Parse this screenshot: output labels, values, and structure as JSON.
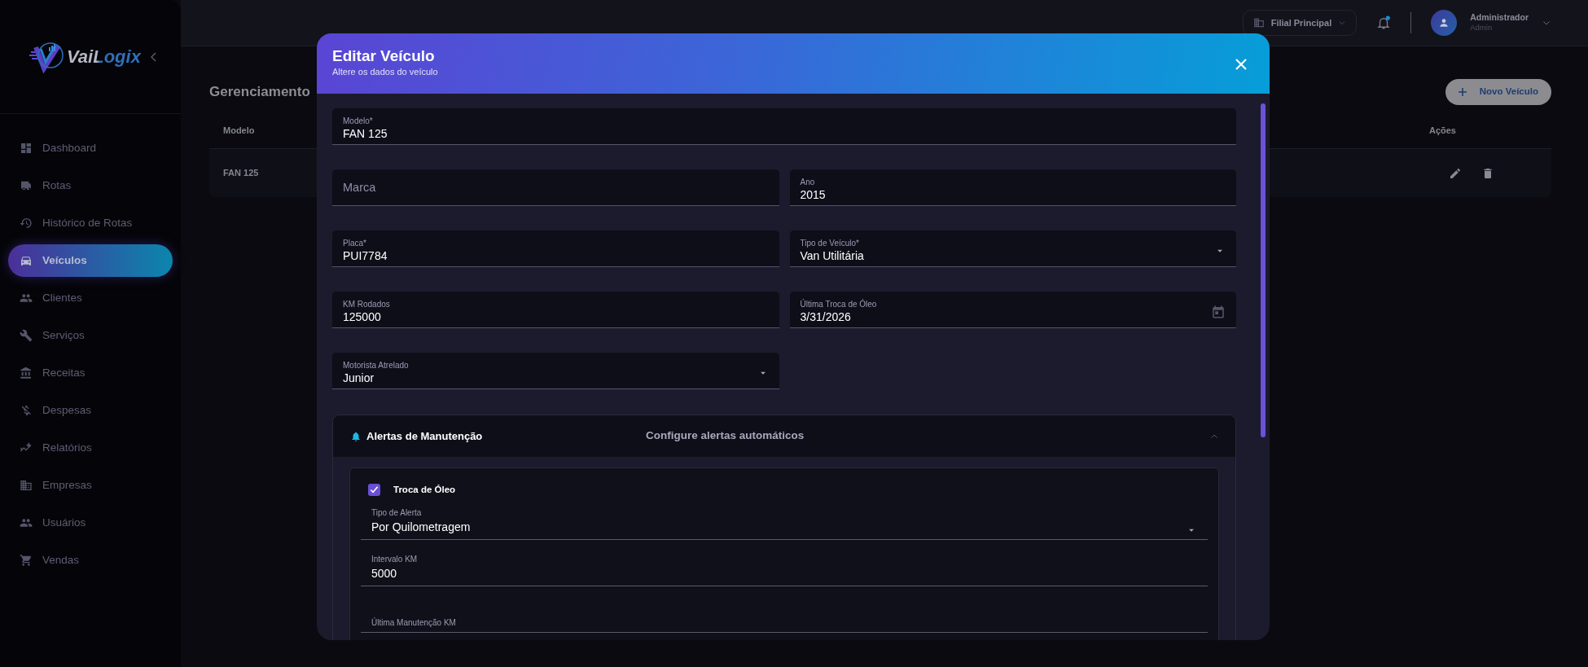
{
  "sidebar": {
    "logo_text": "VaiLogix",
    "items": [
      {
        "label": "Dashboard",
        "selected": false
      },
      {
        "label": "Rotas",
        "selected": false
      },
      {
        "label": "Histórico de Rotas",
        "selected": false
      },
      {
        "label": "Veículos",
        "selected": true
      },
      {
        "label": "Clientes",
        "selected": false
      },
      {
        "label": "Serviços",
        "selected": false
      },
      {
        "label": "Receitas",
        "selected": false
      },
      {
        "label": "Despesas",
        "selected": false
      },
      {
        "label": "Relatórios",
        "selected": false
      },
      {
        "label": "Empresas",
        "selected": false
      },
      {
        "label": "Usuários",
        "selected": false
      },
      {
        "label": "Vendas",
        "selected": false
      }
    ]
  },
  "topbar": {
    "branch": "Filial Principal",
    "notification_unread": true,
    "user": {
      "name": "Administrador",
      "role": "Admin"
    }
  },
  "page": {
    "title": "Gerenciamento",
    "new_button": "Novo Veículo",
    "table": {
      "columns": [
        "Modelo",
        "Ações"
      ],
      "rows": [
        {
          "cells": [
            "FAN 125"
          ]
        }
      ]
    }
  },
  "modal": {
    "title": "Editar Veículo",
    "subtitle": "Altere os dados do veículo",
    "fields": [
      {
        "kind": "text",
        "label": "Modelo*",
        "value": "FAN 125"
      },
      {
        "kind": "text",
        "placeholder": "Marca"
      },
      {
        "kind": "text",
        "label": "Ano",
        "value": "2015"
      },
      {
        "kind": "text",
        "label": "Placa*",
        "value": "PUI7784"
      },
      {
        "kind": "select",
        "label": "Tipo de Veículo*",
        "value": "Van Utilitária"
      },
      {
        "kind": "text",
        "label": "KM Rodados",
        "value": "125000"
      },
      {
        "kind": "date",
        "label": "Última Troca de Óleo",
        "value": "3/31/2026"
      },
      {
        "kind": "select",
        "label": "Motorista Atrelado",
        "value": "Junior"
      }
    ],
    "alerts": {
      "title": "Alertas de Manutenção",
      "subtitle": "Configure alertas automáticos",
      "expanded": true,
      "items": [
        {
          "label": "Troca de Óleo",
          "checked": true,
          "fields": [
            {
              "kind": "select",
              "label": "Tipo de Alerta",
              "value": "Por Quilometragem"
            },
            {
              "kind": "text",
              "label": "Intervalo KM",
              "value": "5000"
            },
            {
              "kind": "text",
              "label": "Última Manutenção KM"
            }
          ]
        }
      ]
    }
  }
}
